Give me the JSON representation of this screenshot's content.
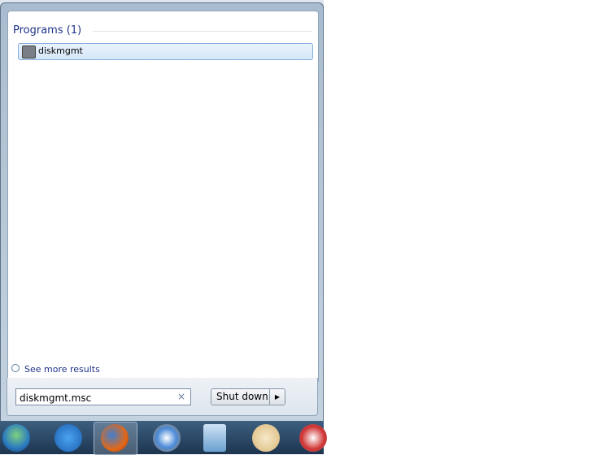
{
  "results": {
    "section_title": "Programs (1)",
    "items": [
      {
        "label": "diskmgmt",
        "icon": "disk-management-icon"
      }
    ],
    "see_more": "See more results"
  },
  "search": {
    "value": "diskmgmt.msc",
    "clear_icon": "×"
  },
  "power": {
    "label": "Shut down",
    "arrow": "▶"
  },
  "taskbar": {
    "items": [
      "start-orb",
      "internet-explorer",
      "firefox",
      "safari",
      "calculator",
      "paint",
      "snipping-tool"
    ]
  }
}
